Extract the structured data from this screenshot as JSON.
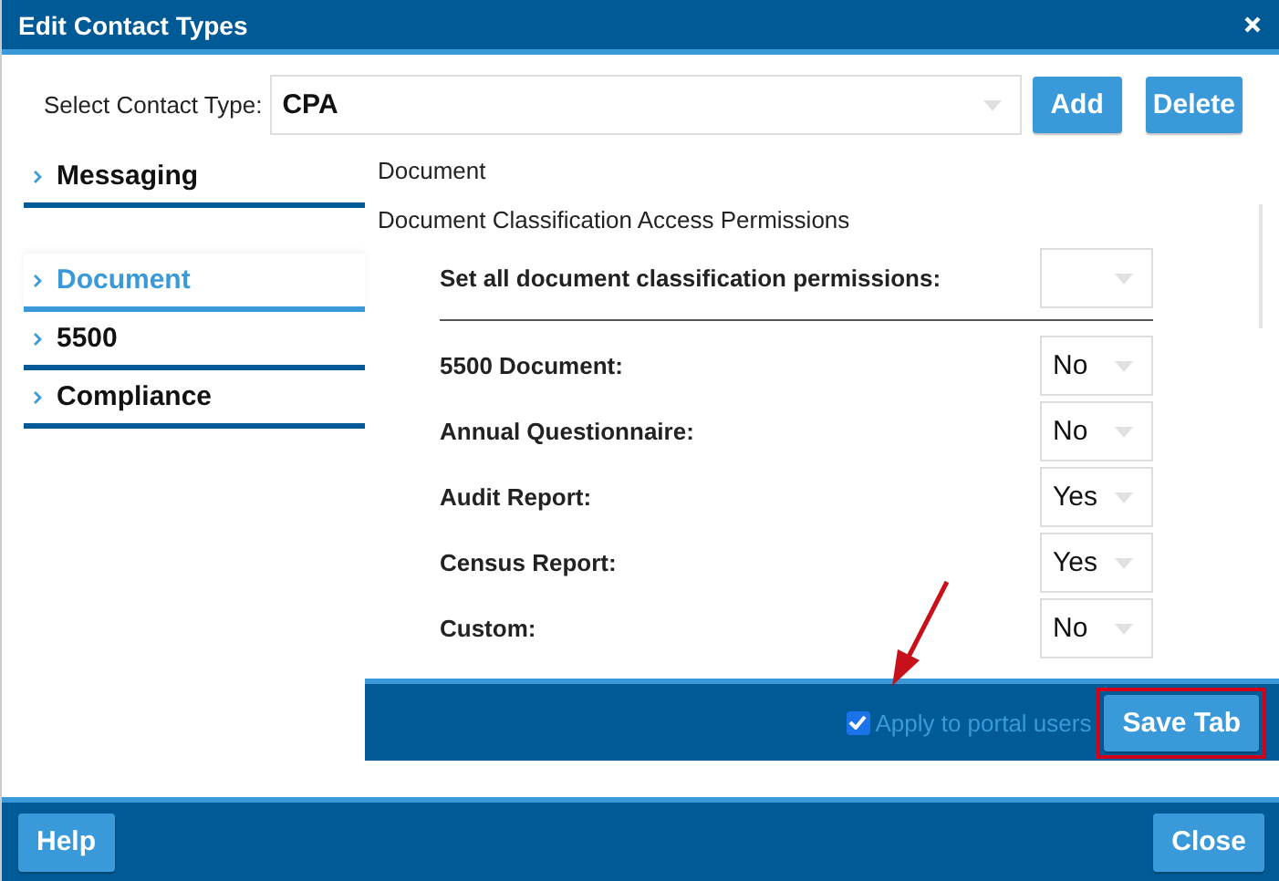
{
  "window": {
    "title": "Edit Contact Types"
  },
  "contact_type": {
    "label": "Select Contact Type:",
    "value": "CPA"
  },
  "top_buttons": [
    "Add",
    "Delete"
  ],
  "sidebar": {
    "items": [
      {
        "label": "Messaging",
        "selected": false
      },
      {
        "label": "Document",
        "selected": true
      },
      {
        "label": "5500",
        "selected": false
      },
      {
        "label": "Compliance",
        "selected": false
      }
    ]
  },
  "content": {
    "heading": "Document",
    "subheading": "Document Classification Access Permissions",
    "set_all": {
      "label": "Set all document classification permissions:"
    },
    "rows": [
      {
        "label": "5500 Document:",
        "value": "No"
      },
      {
        "label": "Annual Questionnaire:",
        "value": "No"
      },
      {
        "label": "Audit Report:",
        "value": "Yes"
      },
      {
        "label": "Census Report:",
        "value": "Yes"
      },
      {
        "label": "Custom:",
        "value": "No"
      }
    ]
  },
  "save_bar": {
    "checkbox": {
      "label": "Apply to portal users",
      "checked": true
    },
    "button": "Save Tab",
    "highlighted": true
  },
  "footer_buttons": [
    "Help",
    "Close"
  ]
}
